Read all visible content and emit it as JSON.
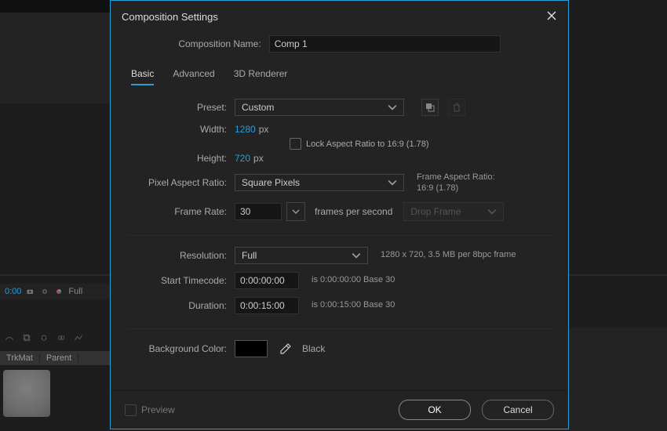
{
  "dialog": {
    "title": "Composition Settings",
    "compNameLabel": "Composition Name:",
    "compName": "Comp 1",
    "tabs": {
      "basic": "Basic",
      "advanced": "Advanced",
      "renderer": "3D Renderer"
    },
    "preset": {
      "label": "Preset:",
      "value": "Custom"
    },
    "width": {
      "label": "Width:",
      "value": "1280",
      "unit": "px"
    },
    "height": {
      "label": "Height:",
      "value": "720",
      "unit": "px"
    },
    "lockAspect": "Lock Aspect Ratio to 16:9 (1.78)",
    "par": {
      "label": "Pixel Aspect Ratio:",
      "value": "Square Pixels",
      "aside1": "Frame Aspect Ratio:",
      "aside2": "16:9 (1.78)"
    },
    "frameRate": {
      "label": "Frame Rate:",
      "value": "30",
      "unit": "frames per second",
      "dropFrame": "Drop Frame"
    },
    "resolution": {
      "label": "Resolution:",
      "value": "Full",
      "aside": "1280 x 720, 3.5 MB per 8bpc frame"
    },
    "startTC": {
      "label": "Start Timecode:",
      "value": "0:00:00:00",
      "aside": "is 0:00:00:00  Base 30"
    },
    "duration": {
      "label": "Duration:",
      "value": "0:00:15:00",
      "aside": "is 0:00:15:00  Base 30"
    },
    "bgColor": {
      "label": "Background Color:",
      "name": "Black",
      "hex": "#000000"
    },
    "preview": "Preview",
    "ok": "OK",
    "cancel": "Cancel"
  },
  "background": {
    "timecode": "0:00",
    "resLabel": "Full",
    "cols": {
      "trkmat": "TrkMat",
      "parent": "Parent"
    }
  }
}
